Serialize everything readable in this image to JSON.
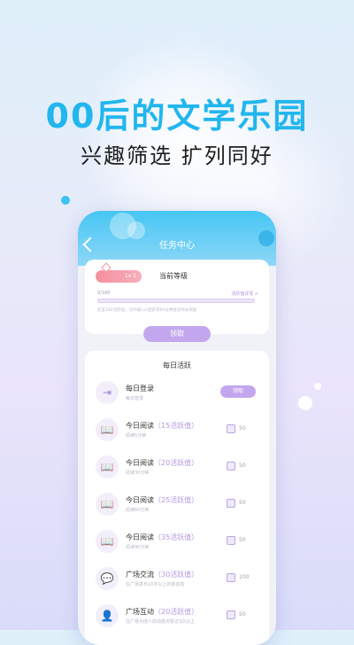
{
  "promo": {
    "headline": "00后的文学乐园",
    "subline": "兴趣筛选 扩列同好"
  },
  "screen": {
    "title": "任务中心",
    "level": {
      "badge": "Lv 1",
      "label": "当前等级",
      "progress_text": "0/180",
      "progress": 0,
      "detail_link": "活跃值详情 >",
      "note": "还差180活跃值，可升级Lv2后获得60分钟会员时长奖励",
      "claim_label": "领取"
    },
    "daily": {
      "title": "每日活跃",
      "tasks": [
        {
          "icon": "login-icon",
          "glyph": "⇥",
          "name": "每日登录",
          "bonus": "",
          "desc": "每日登录",
          "action": "领取"
        },
        {
          "icon": "book-icon",
          "glyph": "📖",
          "name": "今日阅读",
          "bonus": "（15活跃值）",
          "desc": "阅读5分钟",
          "reward": "50"
        },
        {
          "icon": "book-icon",
          "glyph": "📖",
          "name": "今日阅读",
          "bonus": "（20活跃值）",
          "desc": "阅读30分钟",
          "reward": "50"
        },
        {
          "icon": "book-icon",
          "glyph": "📖",
          "name": "今日阅读",
          "bonus": "（25活跃值）",
          "desc": "阅读60分钟",
          "reward": "50"
        },
        {
          "icon": "book-icon",
          "glyph": "📖",
          "name": "今日阅读",
          "bonus": "（35活跃值）",
          "desc": "阅读90分钟",
          "reward": "50"
        },
        {
          "icon": "chat-icon",
          "glyph": "💬",
          "name": "广场交流",
          "bonus": "（30活跃值）",
          "desc": "在广场发布10字以上的新动态",
          "reward": "100"
        },
        {
          "icon": "user-icon",
          "glyph": "👤",
          "name": "广场互动",
          "bonus": "（20活跃值）",
          "desc": "在广场为他人的动态点赞达3次以上",
          "reward": "50"
        }
      ]
    }
  },
  "colors": {
    "headline": "#21b6ee",
    "header": "#47c6f4",
    "accent": "#c3a7ee"
  }
}
